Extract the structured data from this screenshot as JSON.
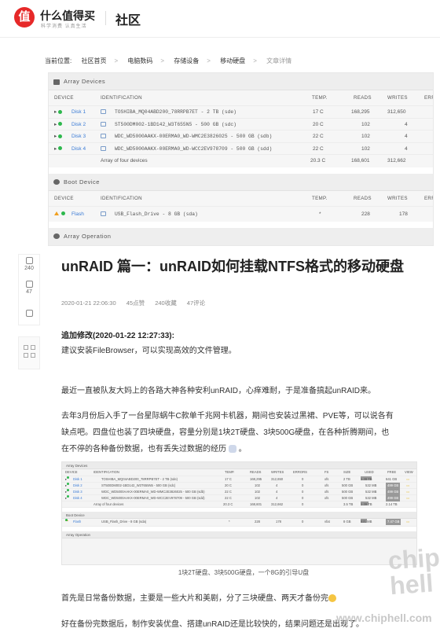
{
  "header": {
    "logo_glyph": "值",
    "logo_text": "什么值得买",
    "logo_sub": "科学消费  认真生活",
    "section": "社区"
  },
  "breadcrumb": {
    "prefix": "当前位置:",
    "items": [
      "社区首页",
      "电脑数码",
      "存储设备",
      "移动硬盘"
    ],
    "separator": ">",
    "current": "文章详情"
  },
  "unraid": {
    "array_title": "Array Devices",
    "columns": [
      "DEVICE",
      "IDENTIFICATION",
      "TEMP.",
      "READS",
      "WRITES",
      "ERR"
    ],
    "disks": [
      {
        "device": "Disk 1",
        "id": "TOSHIBA_MQ04ABD200_78RRPB7ET - 2 TB (sde)",
        "temp": "17 C",
        "reads": "168,295",
        "writes": "312,650"
      },
      {
        "device": "Disk 2",
        "id": "ST500DM002-1BD142_W3T655N5 - 500 GB (sdc)",
        "temp": "20 C",
        "reads": "102",
        "writes": "4"
      },
      {
        "device": "Disk 3",
        "id": "WDC_WD5000AAKX-00ERMA0_WD-WMC2E3826025 - 500 GB (sdb)",
        "temp": "22 C",
        "reads": "102",
        "writes": "4"
      },
      {
        "device": "Disk 4",
        "id": "WDC_WD5000AAKX-00ERMA0_WD-WCC2EV978709 - 500 GB (sdd)",
        "temp": "22 C",
        "reads": "102",
        "writes": "4"
      }
    ],
    "array_total": {
      "label": "Array of four devices",
      "temp": "20.3 C",
      "reads": "168,601",
      "writes": "312,662"
    },
    "boot_title": "Boot Device",
    "boot": {
      "device": "Flash",
      "id": "USB_Flash_Drive - 8 GB (sda)",
      "temp": "*",
      "reads": "228",
      "writes": "178"
    },
    "op_title": "Array Operation"
  },
  "sidebar": {
    "likes": "240",
    "comments": "47"
  },
  "article": {
    "title": "unRAID 篇一：unRAID如何挂载NTFS格式的移动硬盘",
    "date": "2020-01-21 22:06:30",
    "points": "45点赞",
    "fav": "240收藏",
    "comments": "47评论",
    "update_title": "追加修改(2020-01-22 12:27:33):",
    "update_body": "建议安装FileBrowser，可以实现高效的文件管理。",
    "p1": "最近一直被队友大妈上的各路大神各种安利unRAID，心痒难耐，于是准备搞起unRAID来。",
    "p2a": "去年3月份后入手了一台星际蜗牛C款单千兆网卡机器，期间也安装过黑裙、PVE等，可以说各有",
    "p2b": "缺点吧。四盘位也装了四块硬盘，容量分别是1块2T硬盘、3块500G硬盘，在各种折腾期间，也",
    "p2c": "在不停的各种备份数据，也有丢失过数据的经历",
    "p2c_tail": "。",
    "caption": "1块2T硬盘、3块500G硬盘，一个8G的引导U盘",
    "p3": "首先是日常备份数据，主要是一些大片和美剧，分了三块硬盘、两天才备份完",
    "p4": "好在备份完数据后，制作安装优盘、搭建unRAID还是比较快的，结果问题还是出现了。"
  },
  "embed": {
    "columns": [
      "DEVICE",
      "IDENTIFICATION",
      "TEMP.",
      "READS",
      "WRITES",
      "ERRORS",
      "FS",
      "SIZE",
      "USED",
      "FREE",
      "VIEW"
    ],
    "rows": [
      {
        "dev": "Disk 1",
        "id": "TOSHIBA_MQ04ABD200_78RRPB7ET - 2 TB (sde)",
        "temp": "17 C",
        "reads": "168,295",
        "writes": "312,650",
        "err": "0",
        "fs": "xfs",
        "size": "2 TB",
        "used": "1.38 TB",
        "free": "641 GB"
      },
      {
        "dev": "Disk 2",
        "id": "ST500DM002-1BD142_W3T655N5 - 500 GB (sdc)",
        "temp": "20 C",
        "reads": "102",
        "writes": "4",
        "err": "0",
        "fs": "xfs",
        "size": "500 GB",
        "used": "532 MB",
        "free": "499 GB"
      },
      {
        "dev": "Disk 3",
        "id": "WDC_WD5000AAKX-00ERMA0_WD-WMC2E3826025 - 500 GB (sdb)",
        "temp": "22 C",
        "reads": "102",
        "writes": "4",
        "err": "0",
        "fs": "xfs",
        "size": "500 GB",
        "used": "532 MB",
        "free": "499 GB"
      },
      {
        "dev": "Disk 4",
        "id": "WDC_WD5000AAKX-00ERMA0_WD-WCC2EV978709 - 500 GB (sdd)",
        "temp": "22 C",
        "reads": "102",
        "writes": "4",
        "err": "0",
        "fs": "xfs",
        "size": "500 GB",
        "used": "532 MB",
        "free": "499 GB"
      }
    ],
    "total": {
      "label": "Array of four devices",
      "temp": "20.3 C",
      "reads": "168,601",
      "writes": "312,662",
      "err": "0",
      "size": "3.5 TB",
      "used": "1.39 TB",
      "free": "2.14 TB"
    },
    "boot": {
      "dev": "Flash",
      "id": "USB_Flash_Drive - 8 GB (sda)",
      "temp": "*",
      "reads": "228",
      "writes": "178",
      "err": "0",
      "fs": "vfat",
      "size": "8 GB",
      "used": "521 MB",
      "free": "7.47 GB"
    },
    "boot_title": "Boot Device",
    "array_title": "Array Devices",
    "op_title": "Array Operation"
  },
  "watermark": {
    "big": "chip hell",
    "site": "www.chiphell.com"
  },
  "colors": {
    "brand": "#e62828",
    "ok": "#2db84d",
    "warn": "#f0a020",
    "link": "#3a7bd5"
  }
}
